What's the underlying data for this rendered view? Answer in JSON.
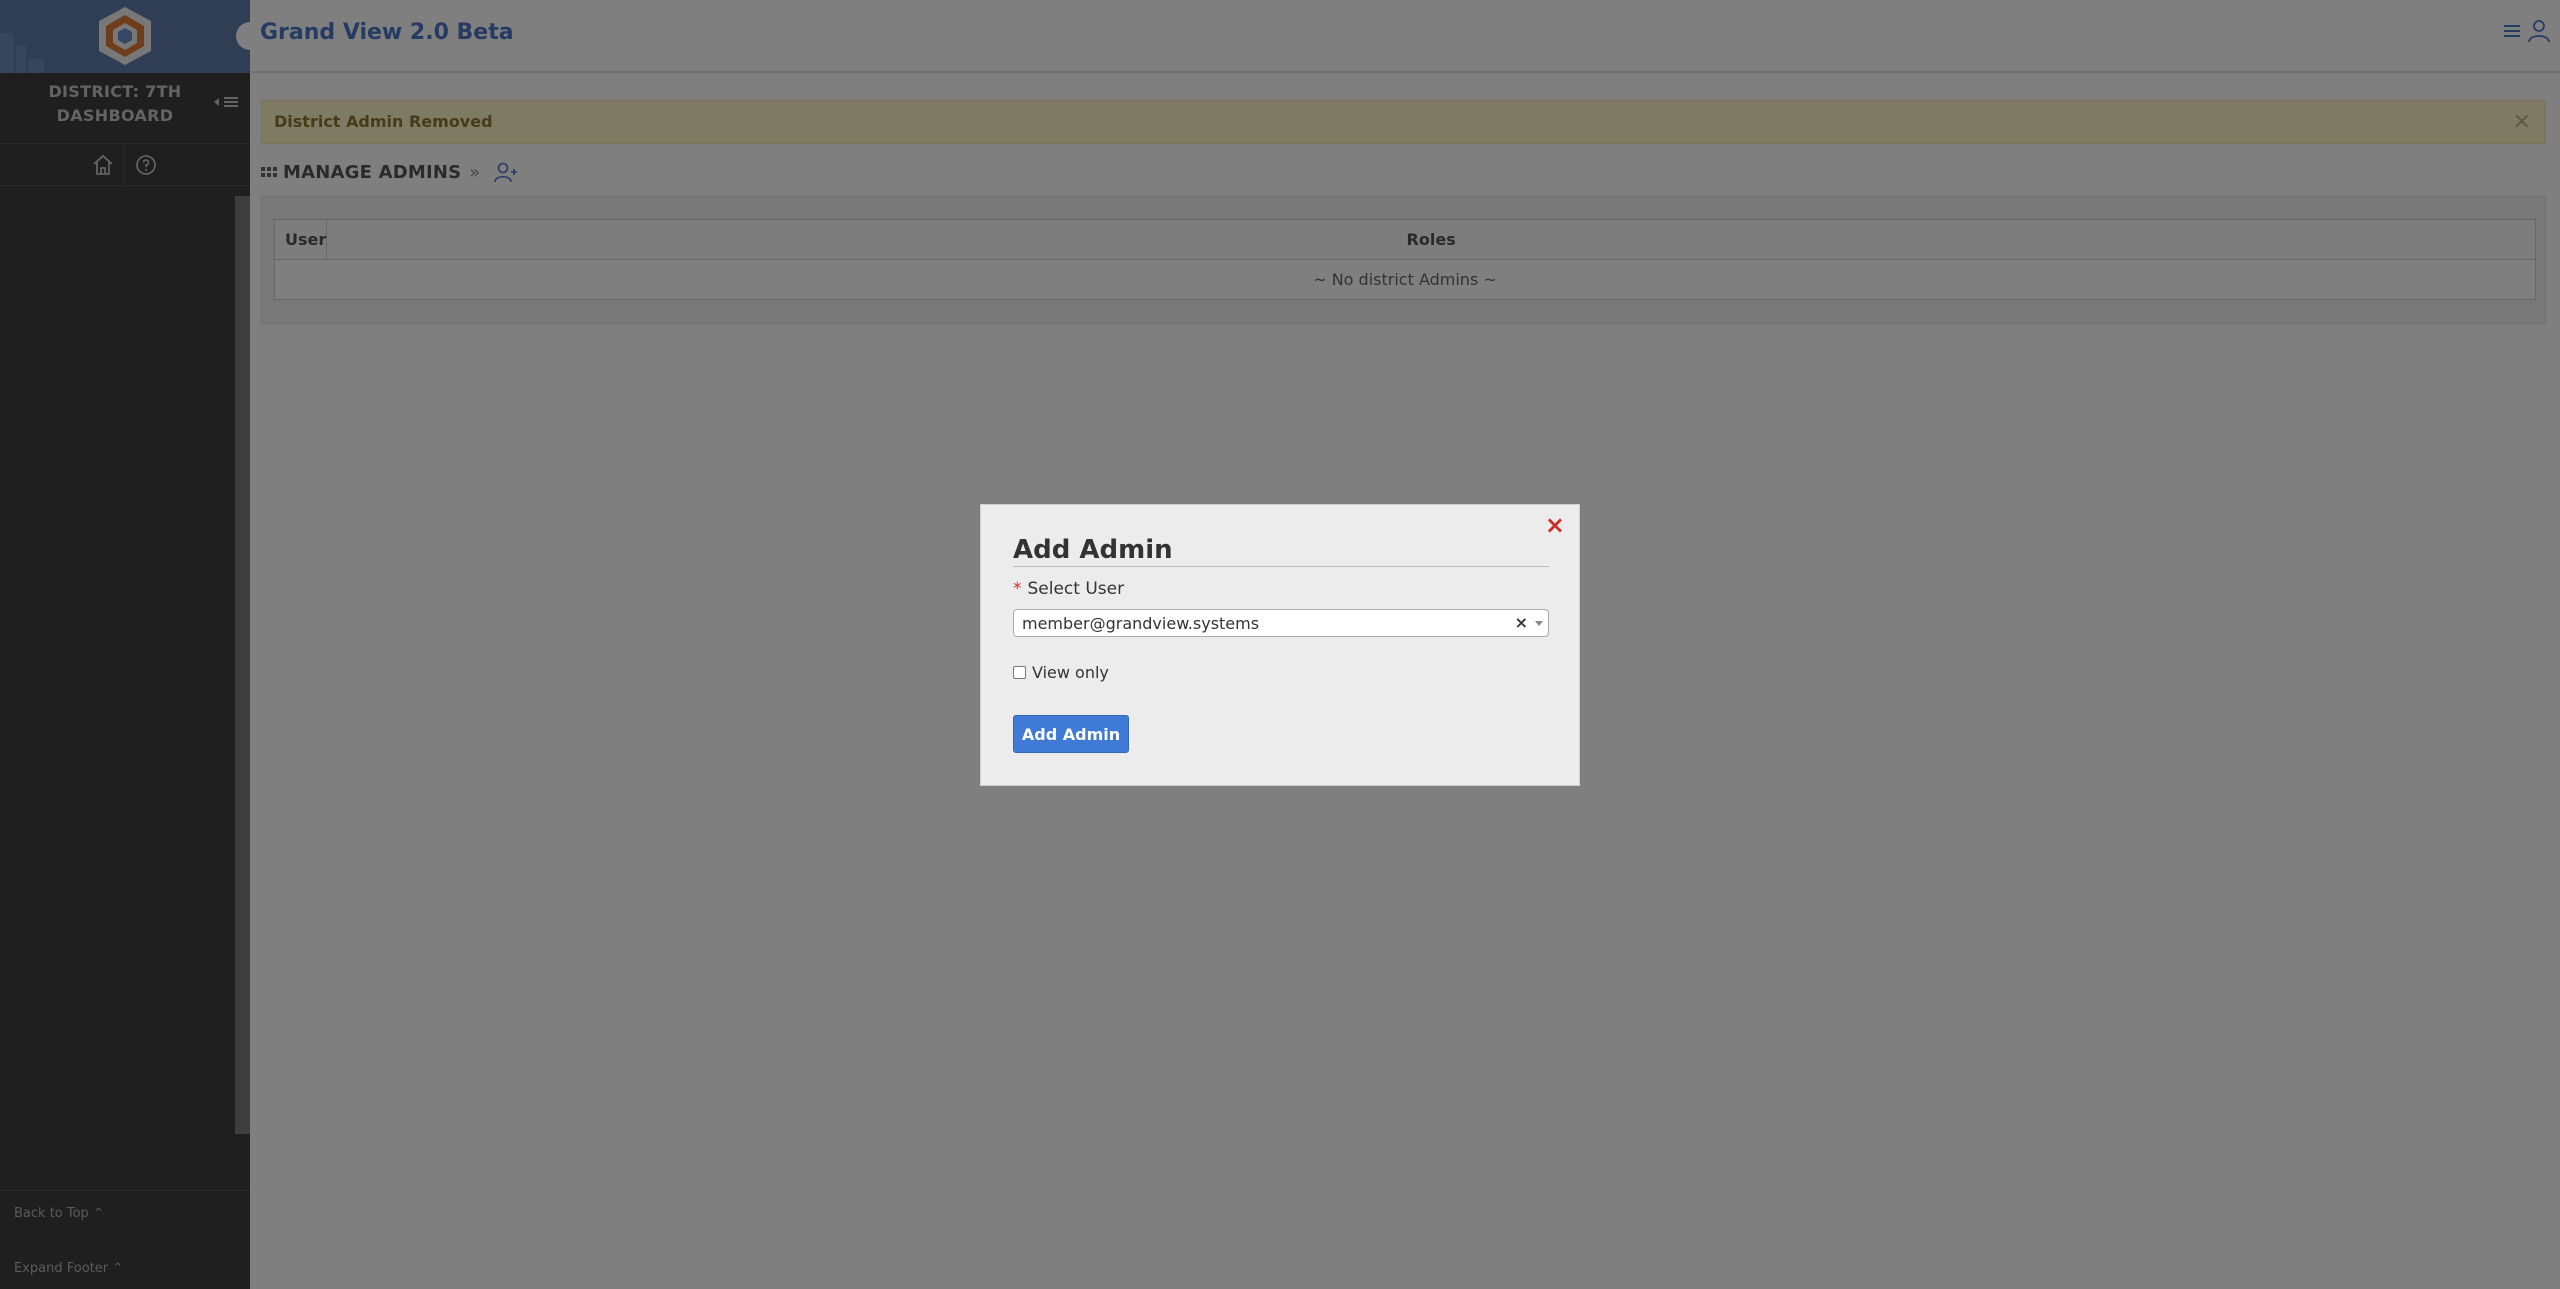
{
  "app": {
    "title": "Grand View 2.0 Beta"
  },
  "sidebar": {
    "district_line1": "DISTRICT: 7TH",
    "district_line2": "DASHBOARD",
    "collapse_label": "",
    "back_to_top": "Back to Top",
    "expand_footer": "Expand Footer"
  },
  "alert": {
    "message": "District Admin Removed",
    "close_glyph": "×"
  },
  "section": {
    "title": "MANAGE ADMINS",
    "chevron": "»"
  },
  "table": {
    "headers": [
      "User",
      "Roles"
    ],
    "empty_message": "~ No district Admins ~"
  },
  "modal": {
    "title": "Add Admin",
    "close_glyph": "×",
    "select_label": "Select User",
    "required_marker": "*",
    "selected_value": "member@grandview.systems",
    "clear_glyph": "×",
    "checkbox_label": "View only",
    "checkbox_checked": false,
    "submit_label": "Add Admin"
  },
  "colors": {
    "accent": "#4a76c5",
    "button": "#3f7bd6",
    "sidebar": "#3f3f3f",
    "alert_bg": "#fcf5c7",
    "close_red": "#c9302c"
  },
  "icons": {
    "home": "home-icon",
    "help": "help-icon",
    "menu": "menu-icon",
    "user": "user-icon",
    "add_user": "add-user-icon",
    "grip": "grip-icon"
  }
}
